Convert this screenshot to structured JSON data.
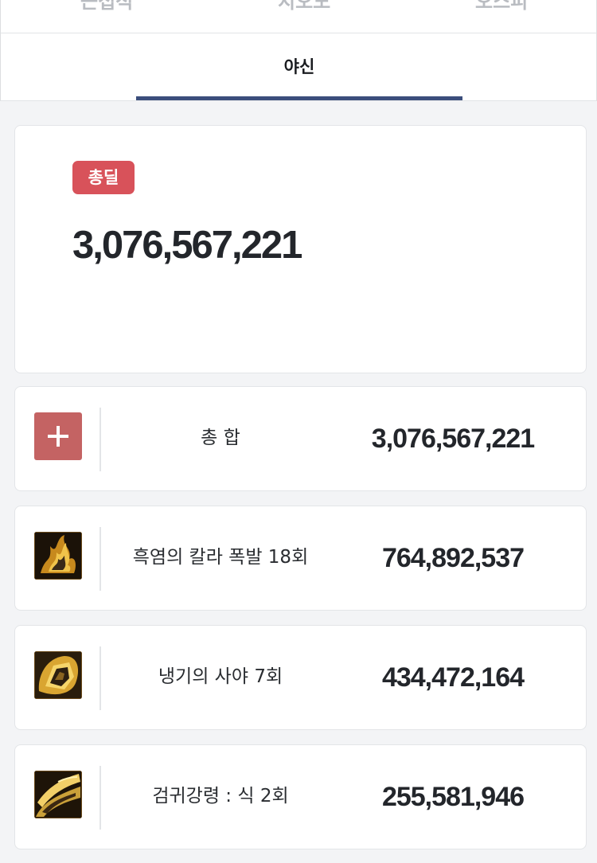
{
  "top_tabs": [
    "근접적",
    "지오도",
    "오스피"
  ],
  "sub_tab": {
    "label": "야신"
  },
  "total": {
    "badge": "총딜",
    "value": "3,076,567,221"
  },
  "rows": [
    {
      "name": "총 합",
      "amount": "3,076,567,221",
      "icon": "plus-icon"
    },
    {
      "name": "흑염의 칼라 폭발 18회",
      "amount": "764,892,537",
      "icon": "black-flame-skill-icon"
    },
    {
      "name": "냉기의 사야 7회",
      "amount": "434,472,164",
      "icon": "frost-sight-skill-icon"
    },
    {
      "name": "검귀강령 : 식 2회",
      "amount": "255,581,946",
      "icon": "sword-spirit-skill-icon"
    }
  ],
  "colors": {
    "accent": "#3b4e7c",
    "badge": "#d8525a",
    "plus": "#c46363"
  }
}
